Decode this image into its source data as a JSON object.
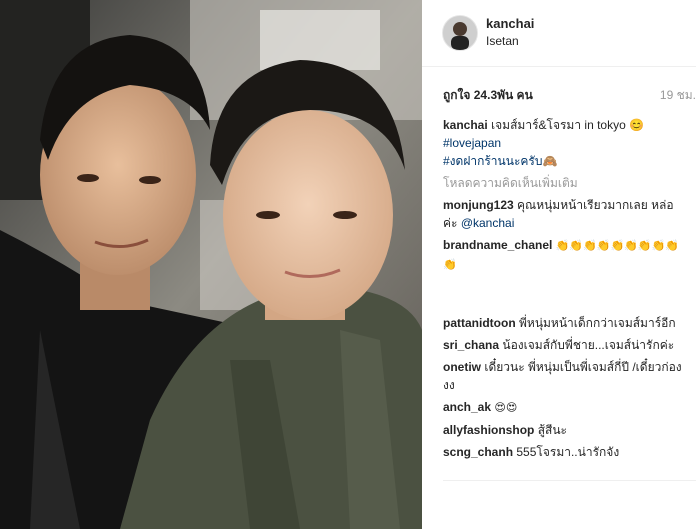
{
  "post": {
    "username": "kanchai",
    "location": "Isetan",
    "likes": "ถูกใจ 24.3พัน คน",
    "time": "19 ชม."
  },
  "caption": {
    "user": "kanchai",
    "text": "เจมส์มาร์&โจรมา in tokyo 😊",
    "tag1": "#lovejapan",
    "tag2": "#งดฝากร้านนะครับ🙈"
  },
  "load_more": "โหลดความคิดเห็นเพิ่มเติม",
  "comments": [
    {
      "user": "monjung123",
      "text": "คุณหนุ่มหน้าเรียวมากเลย หล่อค่ะ",
      "mention": "@kanchai"
    },
    {
      "user": "brandname_chanel",
      "text": "👏👏👏👏👏👏👏👏👏👏"
    },
    {
      "user": "pattanidtoon",
      "text": "พี่หนุ่มหน้าเด็กกว่าเจมส์มาร์อีก"
    },
    {
      "user": "sri_chana",
      "text": "น้องเจมส์กับพี่ชาย...เจมส์น่ารักค่ะ"
    },
    {
      "user": "onetiw",
      "text": "เดี๋ยวนะ พี่หนุ่มเป็นพี่เจมส์กี่ปี /เดี๋ยวก่องงง"
    },
    {
      "user": "anch_ak",
      "text": "😍😍"
    },
    {
      "user": "allyfashionshop",
      "text": "สู้สีนะ"
    },
    {
      "user": "scng_chanh",
      "text": "555โจรมา..น่ารักจัง"
    }
  ]
}
